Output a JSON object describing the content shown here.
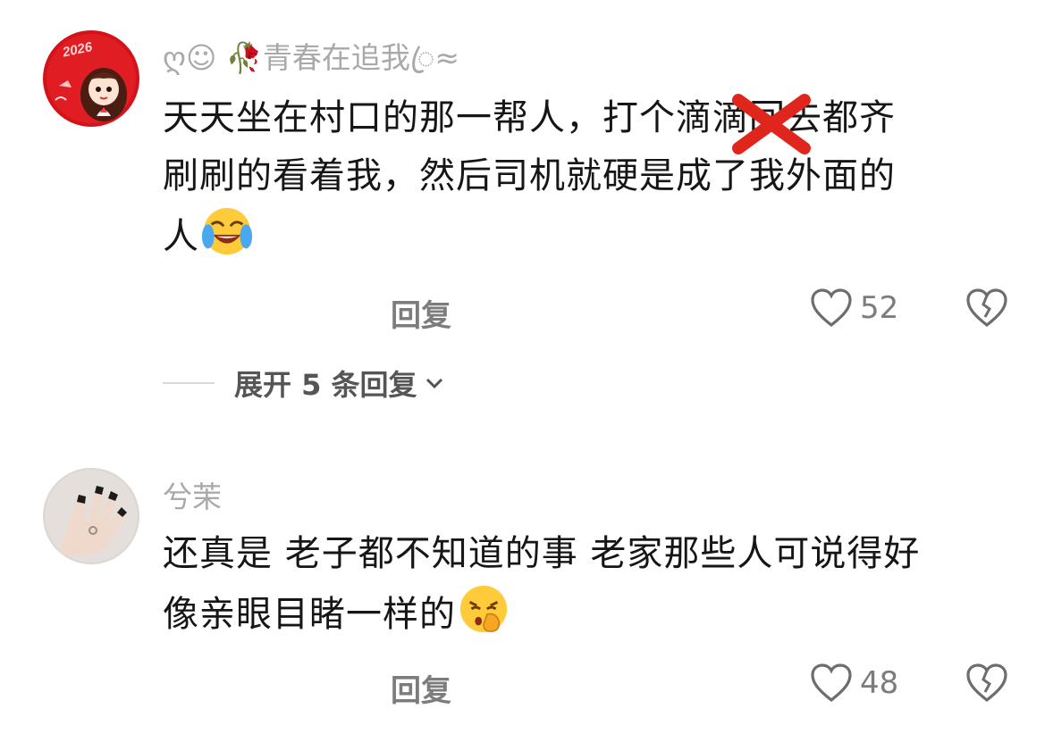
{
  "comments": [
    {
      "username": "ღ☺ 🥀青春在追我ꦿ≈",
      "avatar_text": "2026",
      "body_lines": [
        "天天坐在村口的那一帮人，打个滴滴回去都齐",
        "刷刷的看着我，然后司机就硬是成了我外面的",
        "人"
      ],
      "emoji": "laughing-crying-emoji",
      "reply_label": "回复",
      "likes": "52",
      "expand_label": "展开 5 条回复"
    },
    {
      "username": "兮茉",
      "body_lines": [
        "还真是 老子都不知道的事 老家那些人可说得好",
        "像亲眼目睹一样的"
      ],
      "emoji": "shushing-face-emoji",
      "reply_label": "回复",
      "likes": "48"
    }
  ],
  "colors": {
    "username": "#a9a9a9",
    "text": "#161616",
    "meta": "#7c7c7c",
    "strike_x": "#e0251c"
  },
  "icons": [
    "heart-icon",
    "broken-heart-icon",
    "chevron-down-icon",
    "red-x-mark-icon"
  ]
}
